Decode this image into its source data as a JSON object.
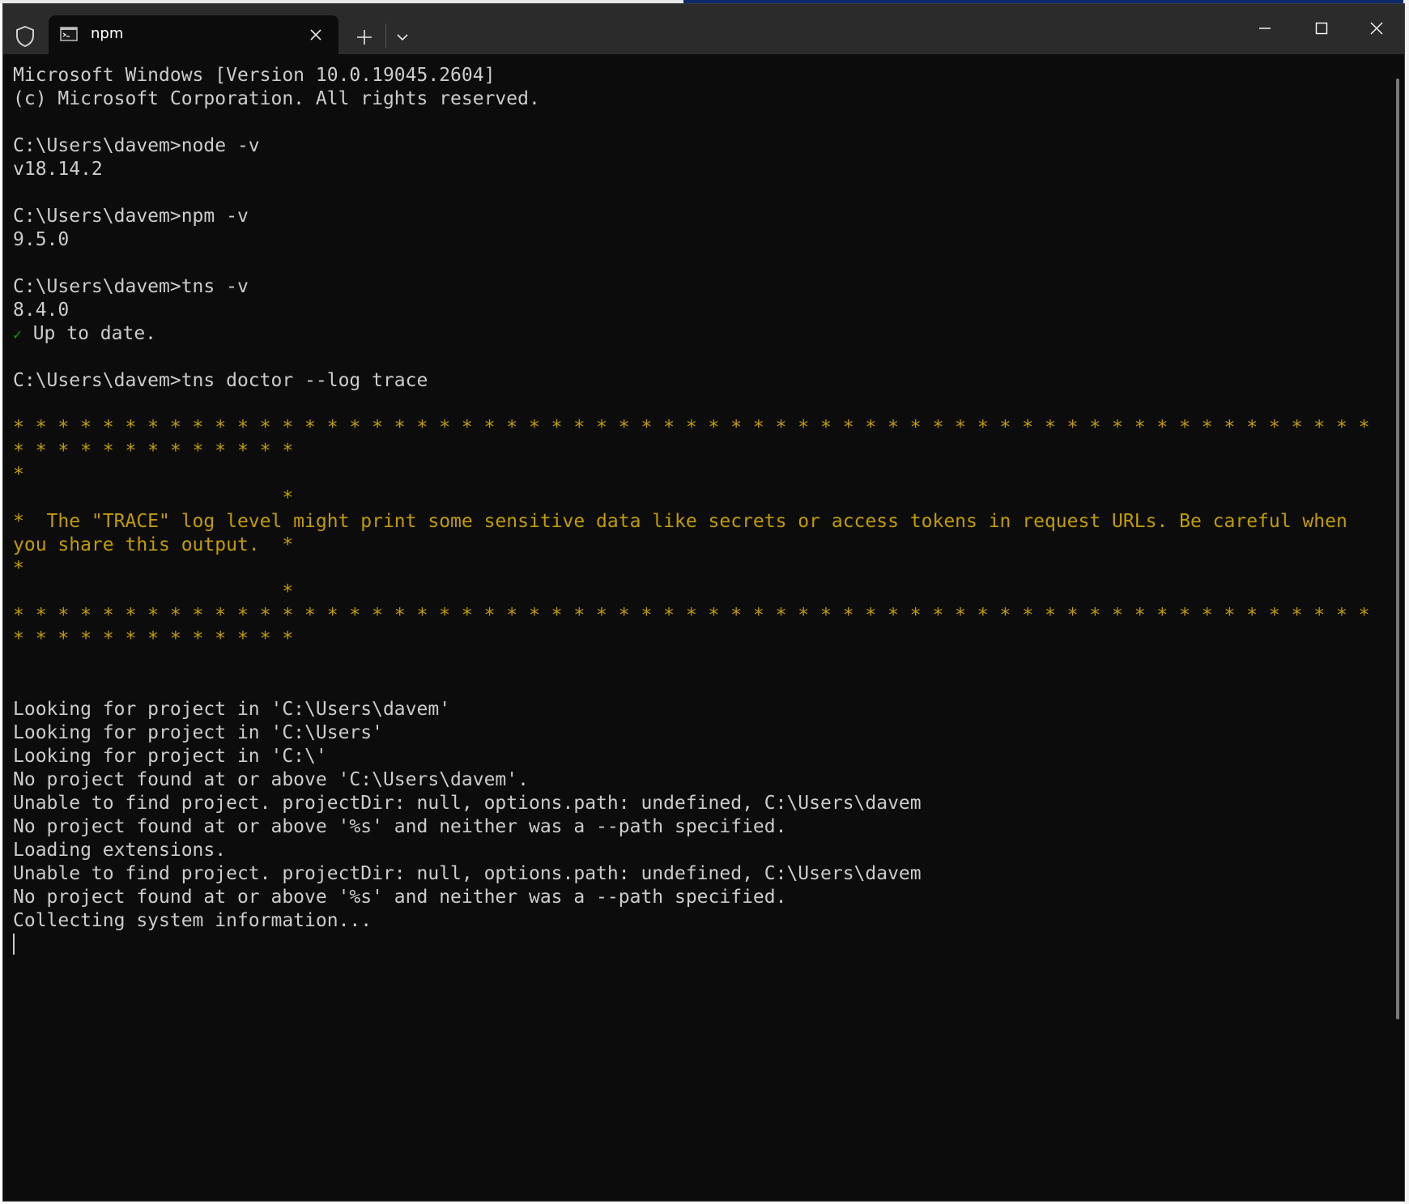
{
  "window": {
    "tab_title": "npm",
    "tab_icon": "terminal-icon",
    "shield_icon": "shield-icon"
  },
  "terminal": {
    "lines": [
      {
        "text": "Microsoft Windows [Version 10.0.19045.2604]",
        "color": "default"
      },
      {
        "text": "(c) Microsoft Corporation. All rights reserved.",
        "color": "default"
      },
      {
        "text": "",
        "color": "default"
      },
      {
        "text": "C:\\Users\\davem>node -v",
        "color": "default"
      },
      {
        "text": "v18.14.2",
        "color": "default"
      },
      {
        "text": "",
        "color": "default"
      },
      {
        "text": "C:\\Users\\davem>npm -v",
        "color": "default"
      },
      {
        "text": "9.5.0",
        "color": "default"
      },
      {
        "text": "",
        "color": "default"
      },
      {
        "text": "C:\\Users\\davem>tns -v",
        "color": "default"
      },
      {
        "text": "8.4.0",
        "color": "default"
      },
      {
        "text": " Up to date.",
        "color": "default",
        "prefix": "✓"
      },
      {
        "text": "",
        "color": "default"
      },
      {
        "text": "C:\\Users\\davem>tns doctor --log trace",
        "color": "default"
      },
      {
        "text": "",
        "color": "default"
      },
      {
        "text": "* * * * * * * * * * * * * * * * * * * * * * * * * * * * * * * * * * * * * * * * * * * * * * * * * * * * * * * * * * * * *",
        "color": "yellow"
      },
      {
        "text": "* * * * * * * * * * * * *",
        "color": "yellow"
      },
      {
        "text": "*",
        "color": "yellow"
      },
      {
        "text": "                        *",
        "color": "yellow"
      },
      {
        "text": "*  The \"TRACE\" log level might print some sensitive data like secrets or access tokens in request URLs. Be careful when",
        "color": "yellow"
      },
      {
        "text": "you share this output.  *",
        "color": "yellow"
      },
      {
        "text": "*",
        "color": "yellow"
      },
      {
        "text": "                        *",
        "color": "yellow"
      },
      {
        "text": "* * * * * * * * * * * * * * * * * * * * * * * * * * * * * * * * * * * * * * * * * * * * * * * * * * * * * * * * * * * * *",
        "color": "yellow"
      },
      {
        "text": "* * * * * * * * * * * * *",
        "color": "yellow"
      },
      {
        "text": "",
        "color": "default"
      },
      {
        "text": "",
        "color": "default"
      },
      {
        "text": "Looking for project in 'C:\\Users\\davem'",
        "color": "default"
      },
      {
        "text": "Looking for project in 'C:\\Users'",
        "color": "default"
      },
      {
        "text": "Looking for project in 'C:\\'",
        "color": "default"
      },
      {
        "text": "No project found at or above 'C:\\Users\\davem'.",
        "color": "default"
      },
      {
        "text": "Unable to find project. projectDir: null, options.path: undefined, C:\\Users\\davem",
        "color": "default"
      },
      {
        "text": "No project found at or above '%s' and neither was a --path specified.",
        "color": "default"
      },
      {
        "text": "Loading extensions.",
        "color": "default"
      },
      {
        "text": "Unable to find project. projectDir: null, options.path: undefined, C:\\Users\\davem",
        "color": "default"
      },
      {
        "text": "No project found at or above '%s' and neither was a --path specified.",
        "color": "default"
      },
      {
        "text": "Collecting system information...",
        "color": "default"
      }
    ]
  },
  "colors": {
    "background": "#0c0c0c",
    "foreground": "#cccccc",
    "warning_yellow": "#c19c00",
    "check_green": "#13a10e",
    "titlebar": "#2b2b2b"
  }
}
